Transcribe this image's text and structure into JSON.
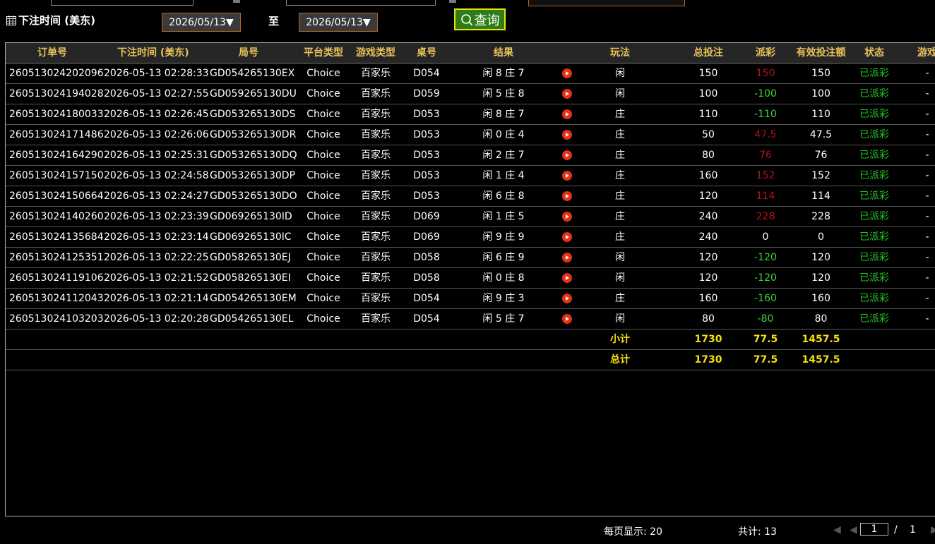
{
  "filters": {
    "time_label": "下注时间 (美东)",
    "start_date": "2026/05/13▼",
    "to_label": "至",
    "end_date": "2026/05/13▼",
    "query_label": "查询"
  },
  "table": {
    "headers": [
      "订单号",
      "下注时间 (美东)",
      "局号",
      "平台类型",
      "游戏类型",
      "桌号",
      "结果",
      "",
      "玩法",
      "总投注",
      "派彩",
      "有效投注额",
      "状态",
      "游戏"
    ],
    "rows": [
      {
        "order": "260513024202096",
        "time": "2026-05-13 02:28:33",
        "round": "GD054265130EX",
        "platform": "Choice",
        "game": "百家乐",
        "table": "D054",
        "result": "闲 8 庄 7",
        "bet": "闲",
        "total": "150",
        "payout": "150",
        "payout_sign": "pos",
        "valid": "150",
        "status": "已派彩",
        "extra": "-"
      },
      {
        "order": "260513024194028",
        "time": "2026-05-13 02:27:55",
        "round": "GD059265130DU",
        "platform": "Choice",
        "game": "百家乐",
        "table": "D059",
        "result": "闲 5 庄 8",
        "bet": "闲",
        "total": "100",
        "payout": "-100",
        "payout_sign": "neg",
        "valid": "100",
        "status": "已派彩",
        "extra": "-"
      },
      {
        "order": "260513024180033",
        "time": "2026-05-13 02:26:45",
        "round": "GD053265130DS",
        "platform": "Choice",
        "game": "百家乐",
        "table": "D053",
        "result": "闲 8 庄 7",
        "bet": "庄",
        "total": "110",
        "payout": "-110",
        "payout_sign": "neg",
        "valid": "110",
        "status": "已派彩",
        "extra": "-"
      },
      {
        "order": "260513024171486",
        "time": "2026-05-13 02:26:06",
        "round": "GD053265130DR",
        "platform": "Choice",
        "game": "百家乐",
        "table": "D053",
        "result": "闲 0 庄 4",
        "bet": "庄",
        "total": "50",
        "payout": "47.5",
        "payout_sign": "pos",
        "valid": "47.5",
        "status": "已派彩",
        "extra": "-"
      },
      {
        "order": "260513024164290",
        "time": "2026-05-13 02:25:31",
        "round": "GD053265130DQ",
        "platform": "Choice",
        "game": "百家乐",
        "table": "D053",
        "result": "闲 2 庄 7",
        "bet": "庄",
        "total": "80",
        "payout": "76",
        "payout_sign": "pos",
        "valid": "76",
        "status": "已派彩",
        "extra": "-"
      },
      {
        "order": "260513024157150",
        "time": "2026-05-13 02:24:58",
        "round": "GD053265130DP",
        "platform": "Choice",
        "game": "百家乐",
        "table": "D053",
        "result": "闲 1 庄 4",
        "bet": "庄",
        "total": "160",
        "payout": "152",
        "payout_sign": "pos",
        "valid": "152",
        "status": "已派彩",
        "extra": "-"
      },
      {
        "order": "260513024150664",
        "time": "2026-05-13 02:24:27",
        "round": "GD053265130DO",
        "platform": "Choice",
        "game": "百家乐",
        "table": "D053",
        "result": "闲 6 庄 8",
        "bet": "庄",
        "total": "120",
        "payout": "114",
        "payout_sign": "pos",
        "valid": "114",
        "status": "已派彩",
        "extra": "-"
      },
      {
        "order": "260513024140260",
        "time": "2026-05-13 02:23:39",
        "round": "GD069265130ID",
        "platform": "Choice",
        "game": "百家乐",
        "table": "D069",
        "result": "闲 1 庄 5",
        "bet": "庄",
        "total": "240",
        "payout": "228",
        "payout_sign": "pos",
        "valid": "228",
        "status": "已派彩",
        "extra": "-"
      },
      {
        "order": "260513024135684",
        "time": "2026-05-13 02:23:14",
        "round": "GD069265130IC",
        "platform": "Choice",
        "game": "百家乐",
        "table": "D069",
        "result": "闲 9 庄 9",
        "bet": "庄",
        "total": "240",
        "payout": "0",
        "payout_sign": "zero",
        "valid": "0",
        "status": "已派彩",
        "extra": "-"
      },
      {
        "order": "260513024125351",
        "time": "2026-05-13 02:22:25",
        "round": "GD058265130EJ",
        "platform": "Choice",
        "game": "百家乐",
        "table": "D058",
        "result": "闲 6 庄 9",
        "bet": "闲",
        "total": "120",
        "payout": "-120",
        "payout_sign": "neg",
        "valid": "120",
        "status": "已派彩",
        "extra": "-"
      },
      {
        "order": "260513024119106",
        "time": "2026-05-13 02:21:52",
        "round": "GD058265130EI",
        "platform": "Choice",
        "game": "百家乐",
        "table": "D058",
        "result": "闲 0 庄 8",
        "bet": "闲",
        "total": "120",
        "payout": "-120",
        "payout_sign": "neg",
        "valid": "120",
        "status": "已派彩",
        "extra": "-"
      },
      {
        "order": "260513024112043",
        "time": "2026-05-13 02:21:14",
        "round": "GD054265130EM",
        "platform": "Choice",
        "game": "百家乐",
        "table": "D054",
        "result": "闲 9 庄 3",
        "bet": "庄",
        "total": "160",
        "payout": "-160",
        "payout_sign": "neg",
        "valid": "160",
        "status": "已派彩",
        "extra": "-"
      },
      {
        "order": "260513024103203",
        "time": "2026-05-13 02:20:28",
        "round": "GD054265130EL",
        "platform": "Choice",
        "game": "百家乐",
        "table": "D054",
        "result": "闲 5 庄 7",
        "bet": "闲",
        "total": "80",
        "payout": "-80",
        "payout_sign": "neg",
        "valid": "80",
        "status": "已派彩",
        "extra": "-"
      }
    ],
    "subtotal": {
      "label": "小计",
      "total": "1730",
      "payout": "77.5",
      "valid": "1457.5"
    },
    "grandtotal": {
      "label": "总计",
      "total": "1730",
      "payout": "77.5",
      "valid": "1457.5"
    }
  },
  "footer": {
    "per_page": "每页显示: 20",
    "total_count": "共计: 13",
    "page_value": "1",
    "page_sep": "/",
    "page_total": "1"
  },
  "colors": {
    "header_text": "#e8c25a",
    "summary_text": "#f5e00a",
    "negative": "#3ad43a",
    "positive": "#b0121c",
    "status": "#22c022",
    "play_icon": "#e53017"
  }
}
